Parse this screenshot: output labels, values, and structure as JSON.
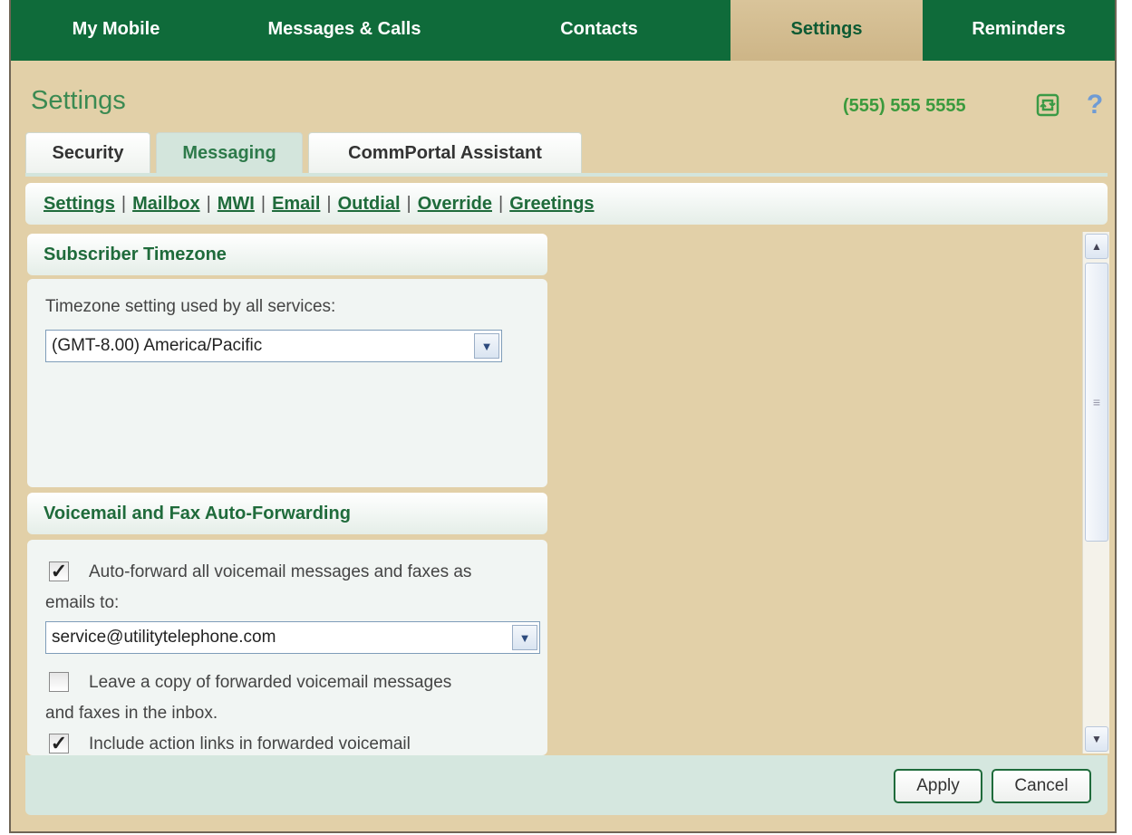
{
  "nav": {
    "tabs": [
      {
        "label": "My Mobile"
      },
      {
        "label": "Messages & Calls"
      },
      {
        "label": "Contacts"
      },
      {
        "label": "Settings"
      },
      {
        "label": "Reminders"
      }
    ],
    "active": "Settings"
  },
  "header": {
    "title": "Settings",
    "phone": "(555) 555 5555",
    "help_glyph": "?"
  },
  "subtabs": [
    {
      "label": "Security"
    },
    {
      "label": "Messaging"
    },
    {
      "label": "CommPortal Assistant"
    }
  ],
  "links": [
    {
      "label": "Settings"
    },
    {
      "label": "Mailbox"
    },
    {
      "label": "MWI"
    },
    {
      "label": "Email"
    },
    {
      "label": "Outdial"
    },
    {
      "label": "Override"
    },
    {
      "label": "Greetings"
    }
  ],
  "timezone": {
    "heading": "Subscriber Timezone",
    "label": "Timezone setting used by all services:",
    "value": "(GMT-8.00) America/Pacific"
  },
  "forwarding": {
    "heading": "Voicemail and Fax Auto-Forwarding",
    "auto_forward_line1": "Auto-forward all voicemail messages and faxes as",
    "auto_forward_line2": "emails to:",
    "auto_forward_checked": true,
    "email_value": "service@utilitytelephone.com",
    "leave_copy_line1": "Leave a copy of forwarded voicemail messages",
    "leave_copy_line2": "and faxes in the inbox.",
    "leave_copy_checked": false,
    "action_links_line1": "Include action links in forwarded voicemail",
    "action_links_checked": true
  },
  "footer": {
    "apply_label": "Apply",
    "cancel_label": "Cancel"
  },
  "colors": {
    "nav_green": "#0f6b3a",
    "page_background": "#e2d0a8",
    "panel_background": "#f1f5f3",
    "link_green": "#1f6b3b"
  },
  "icons": {
    "refresh": "refresh-icon",
    "help": "help-icon",
    "dropdown": "chevron-down-icon",
    "check": "check-icon"
  }
}
